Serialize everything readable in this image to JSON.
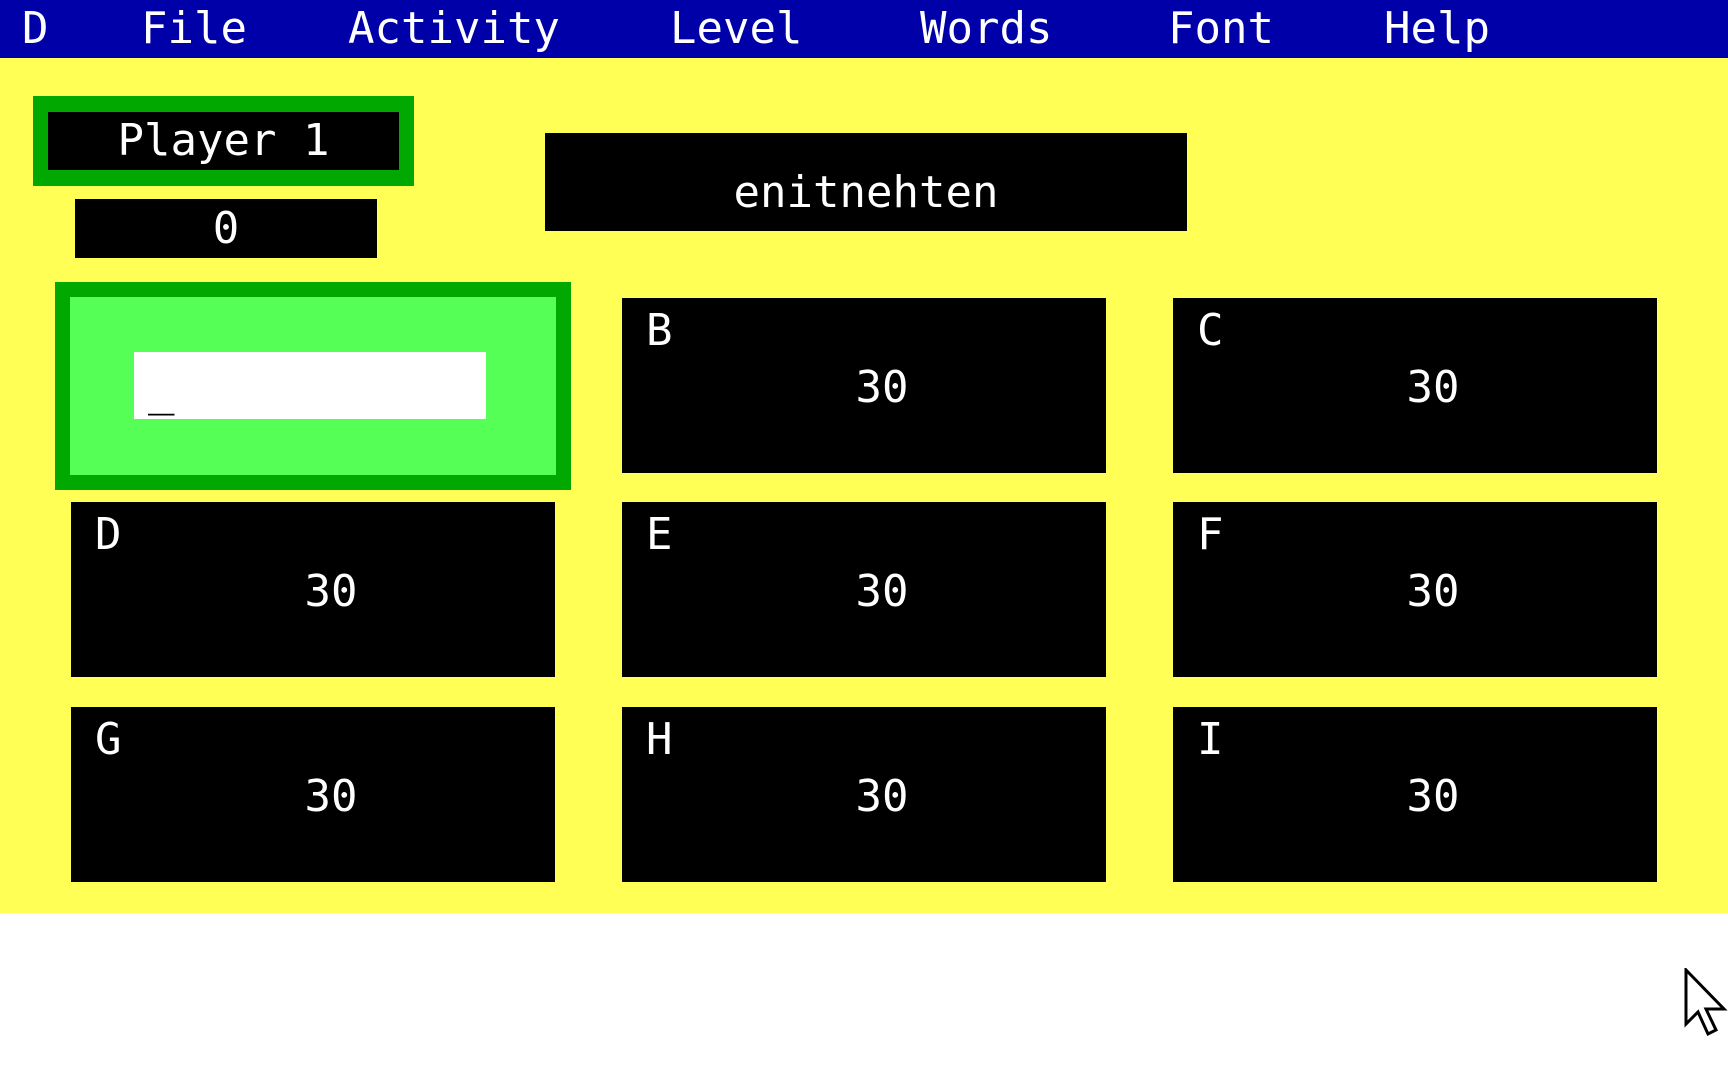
{
  "menu": [
    "D",
    "File",
    "Activity",
    "Level",
    "Words",
    "Font",
    "Help"
  ],
  "player": {
    "name": "Player 1",
    "score": "0"
  },
  "word": "enitnehten",
  "active_cell": {
    "value": "_"
  },
  "cells": [
    {
      "label": "B",
      "value": "30"
    },
    {
      "label": "C",
      "value": "30"
    },
    {
      "label": "D",
      "value": "30"
    },
    {
      "label": "E",
      "value": "30"
    },
    {
      "label": "F",
      "value": "30"
    },
    {
      "label": "G",
      "value": "30"
    },
    {
      "label": "H",
      "value": "30"
    },
    {
      "label": "I",
      "value": "30"
    }
  ],
  "colors": {
    "menubar": "#0000a8",
    "board": "#ffff55",
    "active_fill": "#55ff55",
    "active_border": "#00a800"
  }
}
